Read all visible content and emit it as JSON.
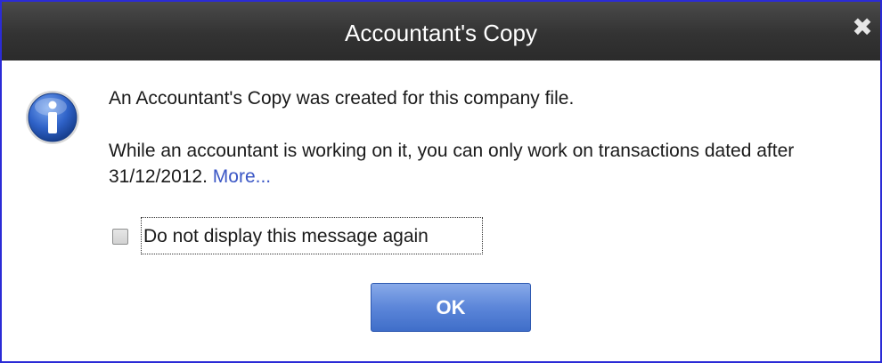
{
  "dialog": {
    "title": "Accountant's Copy",
    "close_label": "✖",
    "icon": "info-icon",
    "message_line1": "An Accountant's Copy was created for this company file.",
    "message_line2": "While an accountant is working on it, you can only work on transactions dated after 31/12/2012.",
    "more_link": "More...",
    "checkbox_label": "Do not display this message again",
    "checkbox_checked": false,
    "ok_label": "OK"
  },
  "colors": {
    "window_border": "#2b2bd6",
    "titlebar": "#333333",
    "link": "#3a56c5",
    "ok_button": "#5c86d9"
  }
}
